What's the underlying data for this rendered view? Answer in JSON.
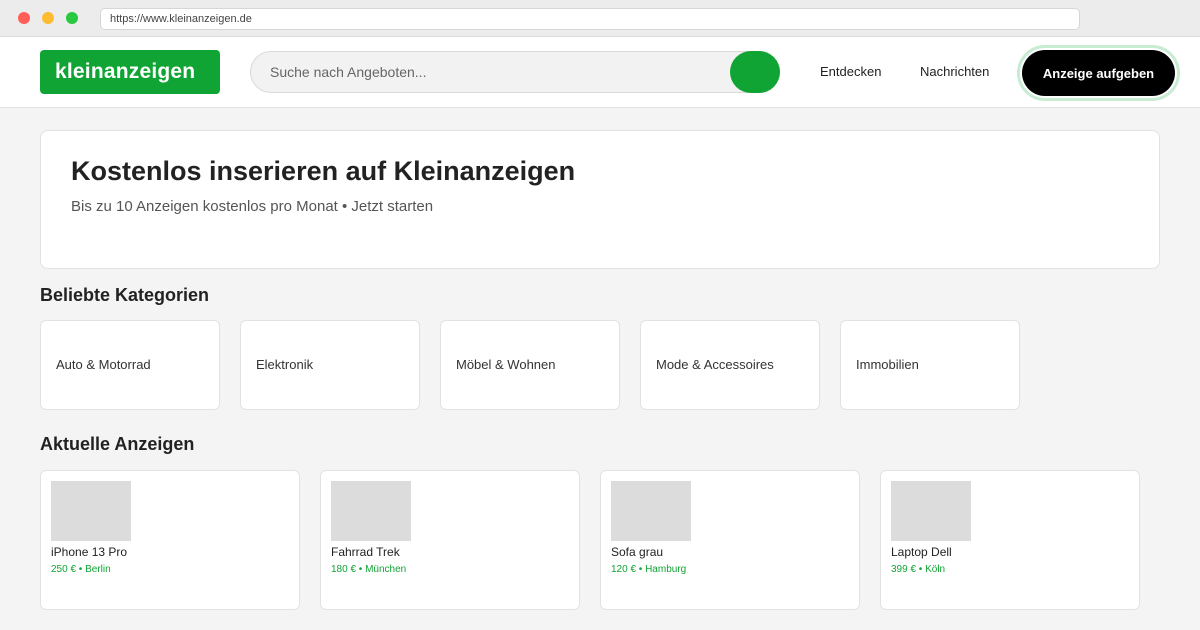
{
  "browser": {
    "url": "https://www.kleinanzeigen.de"
  },
  "header": {
    "logo": "kleinanzeigen",
    "search_placeholder": "Suche nach Angeboten...",
    "nav": {
      "discover": "Entdecken",
      "messages": "Nachrichten"
    },
    "post_button": "Anzeige aufgeben"
  },
  "hero": {
    "title": "Kostenlos inserieren auf Kleinanzeigen",
    "subtitle": "Bis zu 10 Anzeigen kostenlos pro Monat • Jetzt starten"
  },
  "categories": {
    "title": "Beliebte Kategorien",
    "items": [
      {
        "label": "Auto & Motorrad"
      },
      {
        "label": "Elektronik"
      },
      {
        "label": "Möbel & Wohnen"
      },
      {
        "label": "Mode & Accessoires"
      },
      {
        "label": "Immobilien"
      }
    ]
  },
  "ads": {
    "title": "Aktuelle Anzeigen",
    "items": [
      {
        "title": "iPhone 13 Pro",
        "meta": "250 € • Berlin"
      },
      {
        "title": "Fahrrad Trek",
        "meta": "180 € • München"
      },
      {
        "title": "Sofa grau",
        "meta": "120 € • Hamburg"
      },
      {
        "title": "Laptop Dell",
        "meta": "399 € • Köln"
      }
    ]
  },
  "colors": {
    "brand_green": "#0fa433",
    "post_button_bg": "#000000"
  }
}
